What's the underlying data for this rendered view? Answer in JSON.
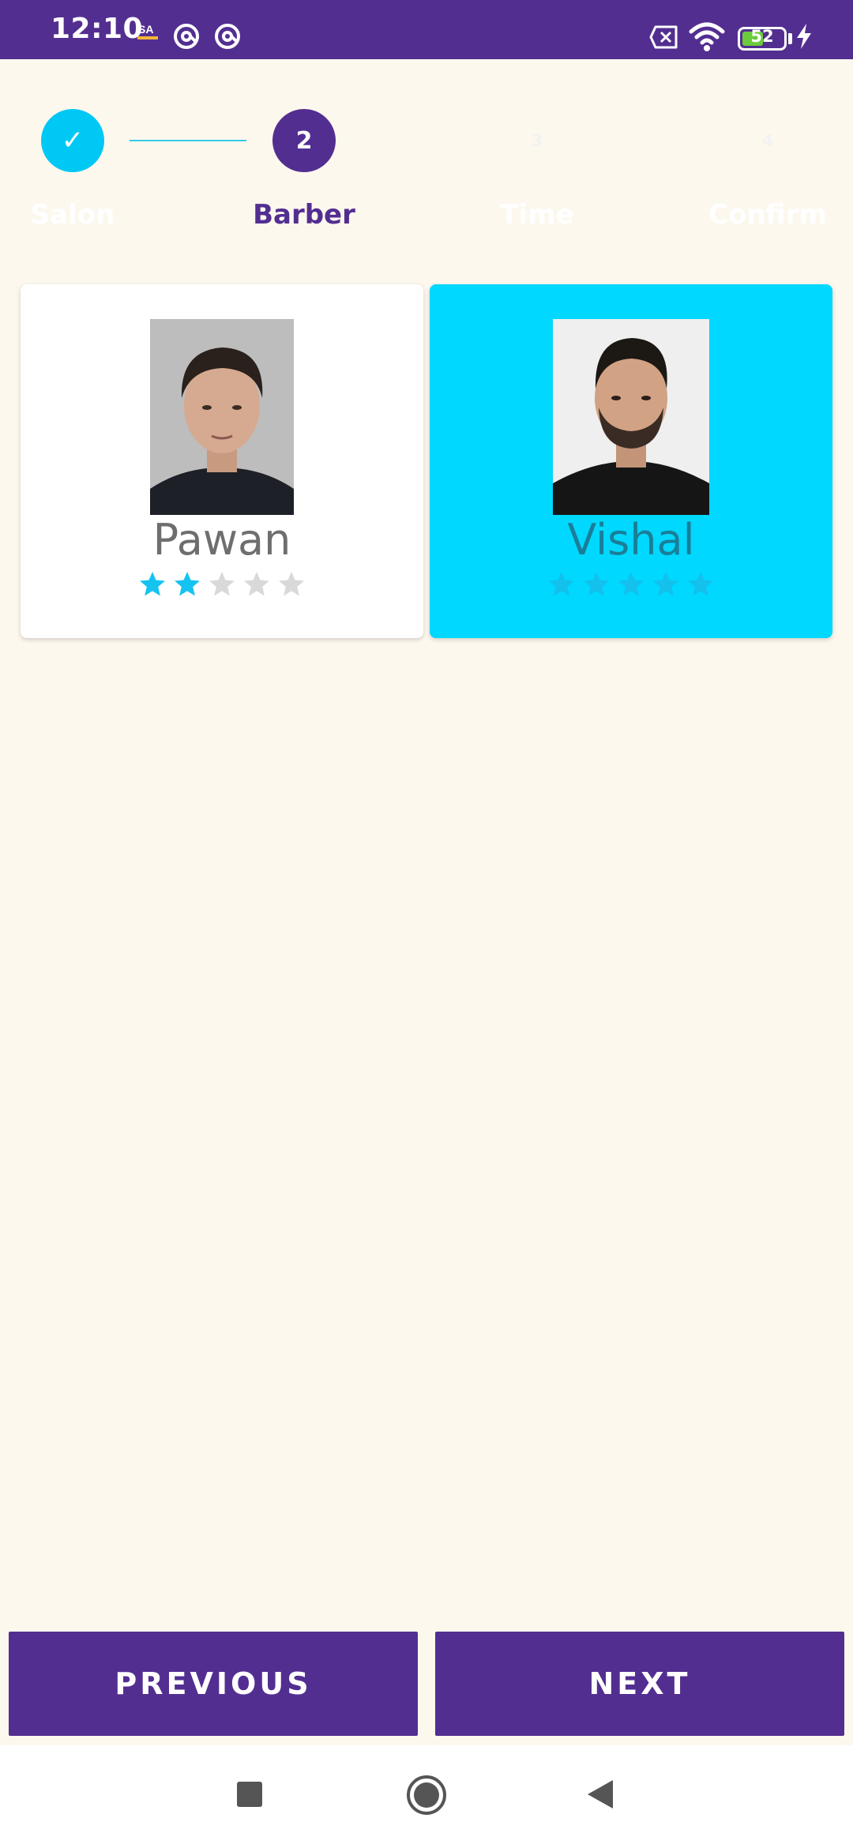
{
  "status_bar": {
    "time": "12:10",
    "battery_percent": "52",
    "battery_level": 0.52,
    "icons": [
      "app-notification-icon",
      "at-sign-icon",
      "at-sign-icon",
      "sim-off-icon",
      "wifi-icon",
      "battery-icon",
      "charging-bolt-icon"
    ]
  },
  "stepper": {
    "steps": [
      {
        "label": "Salon",
        "number": "1",
        "state": "completed"
      },
      {
        "label": "Barber",
        "number": "2",
        "state": "active"
      },
      {
        "label": "Time",
        "number": "3",
        "state": "upcoming"
      },
      {
        "label": "Confirm",
        "number": "4",
        "state": "upcoming"
      }
    ],
    "check_glyph": "✓"
  },
  "barbers": [
    {
      "name": "Pawan",
      "rating": 2,
      "max_rating": 5,
      "selected": false
    },
    {
      "name": "Vishal",
      "rating": 5,
      "max_rating": 5,
      "selected": true
    }
  ],
  "buttons": {
    "previous": "PREVIOUS",
    "next": "NEXT"
  },
  "colors": {
    "primary": "#532E91",
    "accent": "#00D8FF",
    "background": "#FDF8EE",
    "star_on": "#15C3F0",
    "star_off": "#D9D9D9",
    "star_selected": "#14C0EC"
  },
  "nav_bar": {
    "icons": [
      "recents-square-icon",
      "home-circle-icon",
      "back-triangle-icon"
    ]
  }
}
